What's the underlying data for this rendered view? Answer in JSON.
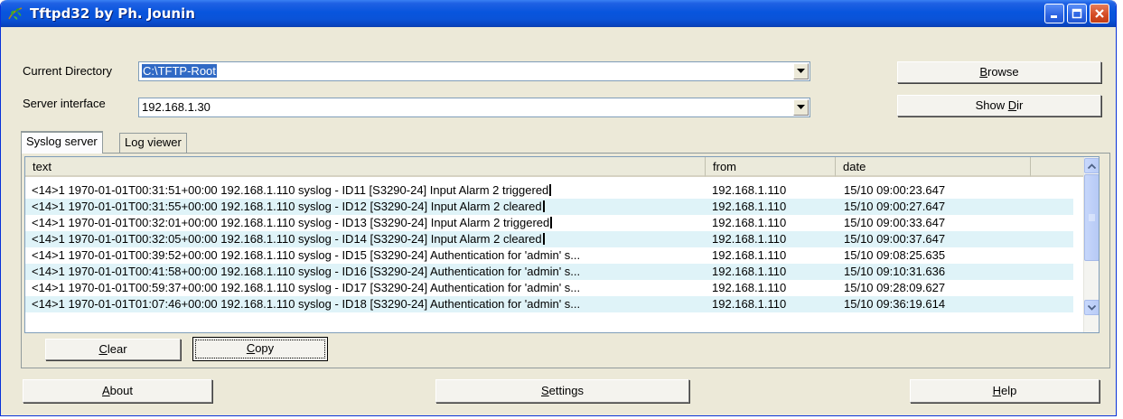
{
  "window": {
    "title": "Tftpd32 by Ph. Jounin"
  },
  "settings": {
    "current_directory_label": "Current Directory",
    "current_directory_value": "C:\\TFTP-Root",
    "server_interface_label": "Server interface",
    "server_interface_value": "192.168.1.30"
  },
  "buttons": {
    "browse": {
      "pre": "",
      "key": "B",
      "post": "rowse"
    },
    "showdir": {
      "pre": "Show ",
      "key": "D",
      "post": "ir"
    },
    "clear": {
      "pre": "",
      "key": "C",
      "post": "lear"
    },
    "copy": {
      "pre": "",
      "key": "C",
      "post": "opy"
    },
    "about": {
      "pre": "",
      "key": "A",
      "post": "bout"
    },
    "settings": {
      "pre": "",
      "key": "S",
      "post": "ettings"
    },
    "help": {
      "pre": "",
      "key": "H",
      "post": "elp"
    }
  },
  "tabs": [
    "Syslog server",
    "Log viewer"
  ],
  "log": {
    "columns": [
      "text",
      "from",
      "date"
    ],
    "rows": [
      {
        "text": "<14>1 1970-01-01T00:31:51+00:00 192.168.1.110 syslog - ID11 [S3290-24] Input Alarm 2 triggered",
        "from": "192.168.1.110",
        "date": "15/10 09:00:23.647"
      },
      {
        "text": "<14>1 1970-01-01T00:31:55+00:00 192.168.1.110 syslog - ID12 [S3290-24] Input Alarm 2 cleared",
        "from": "192.168.1.110",
        "date": "15/10 09:00:27.647"
      },
      {
        "text": "<14>1 1970-01-01T00:32:01+00:00 192.168.1.110 syslog - ID13 [S3290-24] Input Alarm 2 triggered",
        "from": "192.168.1.110",
        "date": "15/10 09:00:33.647"
      },
      {
        "text": "<14>1 1970-01-01T00:32:05+00:00 192.168.1.110 syslog - ID14 [S3290-24] Input Alarm 2 cleared",
        "from": "192.168.1.110",
        "date": "15/10 09:00:37.647"
      },
      {
        "text": "<14>1 1970-01-01T00:39:52+00:00 192.168.1.110 syslog - ID15 [S3290-24] Authentication for 'admin' s...",
        "from": "192.168.1.110",
        "date": "15/10 09:08:25.635"
      },
      {
        "text": "<14>1 1970-01-01T00:41:58+00:00 192.168.1.110 syslog - ID16 [S3290-24] Authentication for 'admin' s...",
        "from": "192.168.1.110",
        "date": "15/10 09:10:31.636"
      },
      {
        "text": "<14>1 1970-01-01T00:59:37+00:00 192.168.1.110 syslog - ID17 [S3290-24] Authentication for 'admin' s...",
        "from": "192.168.1.110",
        "date": "15/10 09:28:09.627"
      },
      {
        "text": "<14>1 1970-01-01T01:07:46+00:00 192.168.1.110 syslog - ID18 [S3290-24] Authentication for 'admin' s...",
        "from": "192.168.1.110",
        "date": "15/10 09:36:19.614"
      }
    ]
  },
  "icons": {
    "app": "tftpd-leaf-icon",
    "minimize": "minimize-icon",
    "maximize": "maximize-icon",
    "close": "close-icon"
  },
  "colors": {
    "titlebar": "#0855dd",
    "selection": "#316ac5",
    "row_alt": "#dff3f8",
    "close_button": "#d44a22"
  }
}
